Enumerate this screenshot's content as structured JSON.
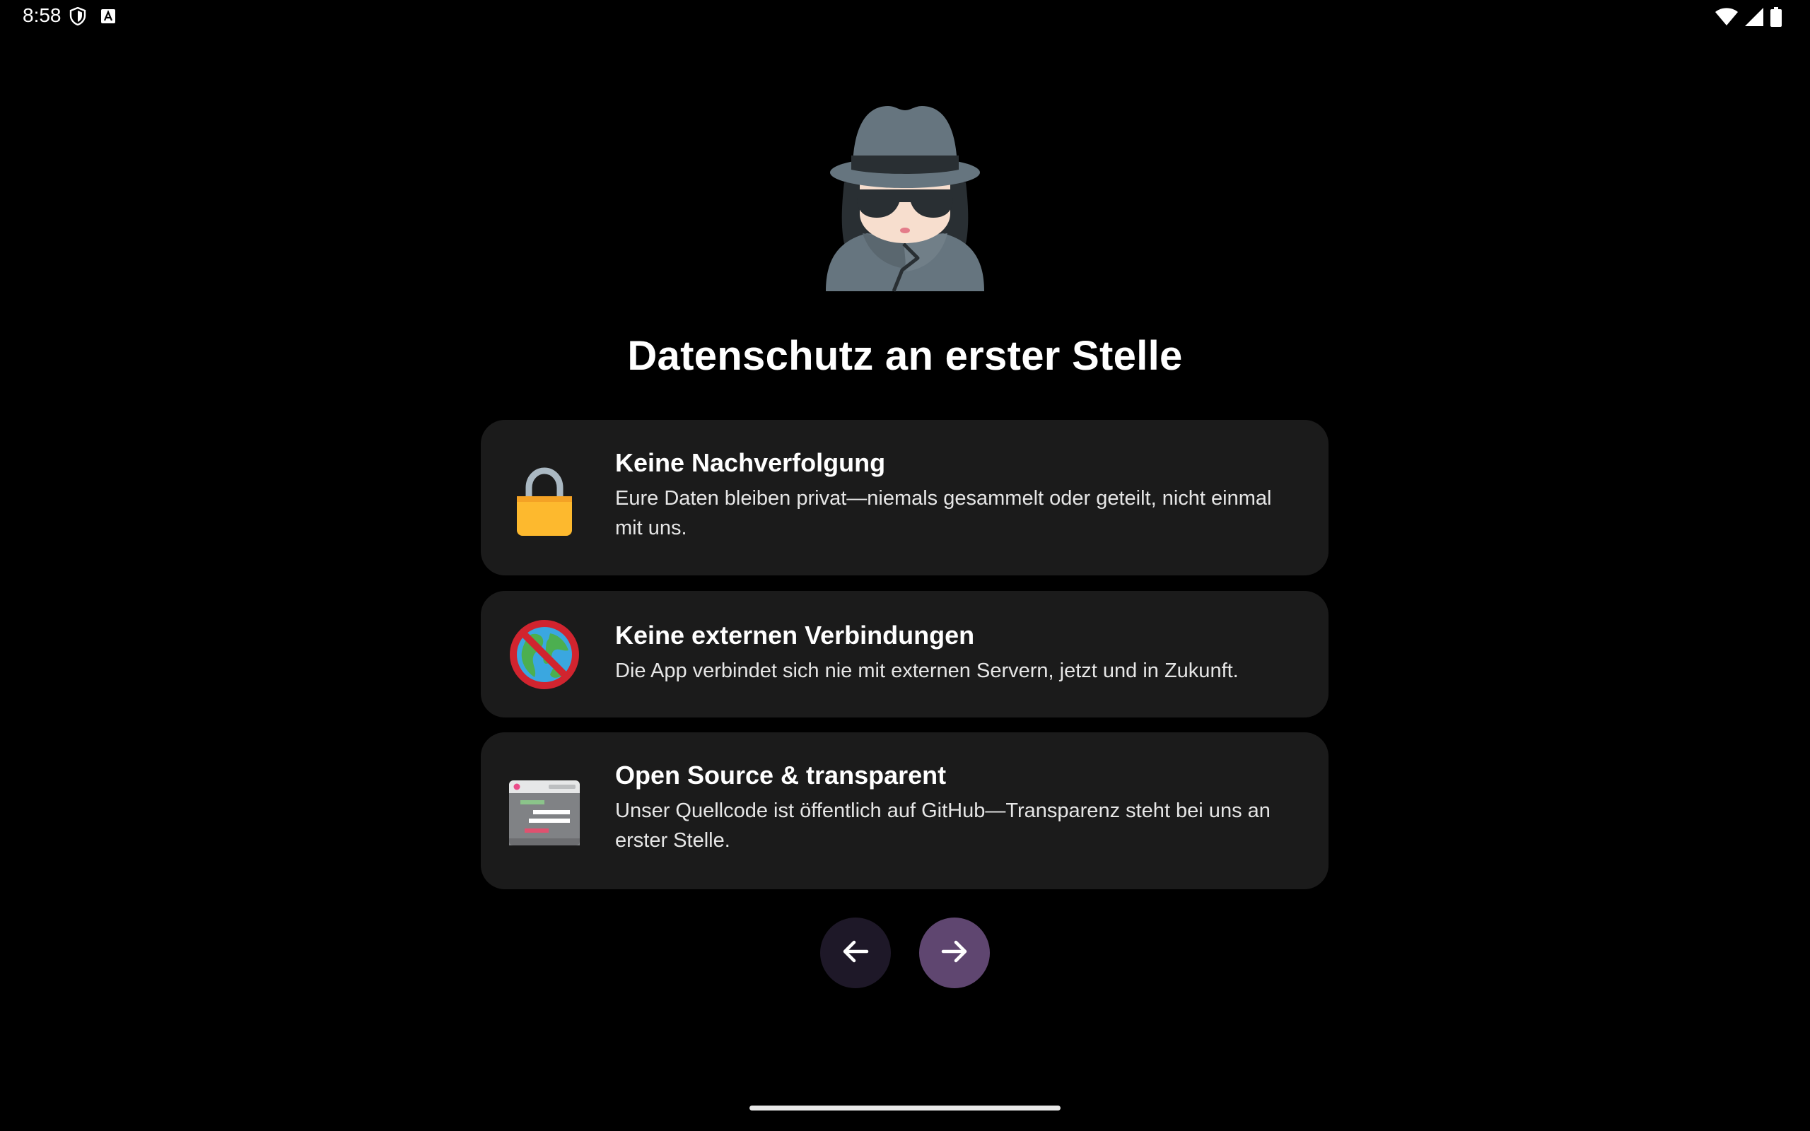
{
  "status_bar": {
    "time": "8:58",
    "left_icons": [
      "shield-icon",
      "keyboard-a-icon"
    ],
    "right_icons": [
      "wifi-icon",
      "cellular-signal-icon",
      "battery-icon"
    ]
  },
  "hero": {
    "icon": "detective-icon"
  },
  "title": "Datenschutz an erster Stelle",
  "cards": [
    {
      "icon": "lock-icon",
      "title": "Keine Nachverfolgung",
      "description": "Eure Daten bleiben privat—niemals gesammelt oder geteilt, nicht einmal mit uns."
    },
    {
      "icon": "no-globe-icon",
      "title": "Keine externen Verbindungen",
      "description": "Die App verbindet sich nie mit externen Servern, jetzt und in Zukunft."
    },
    {
      "icon": "code-window-icon",
      "title": "Open Source & transparent",
      "description": "Unser Quellcode ist öffentlich auf GitHub—Transparenz steht bei uns an erster Stelle."
    }
  ],
  "navigation": {
    "back_icon": "arrow-left-icon",
    "next_icon": "arrow-right-icon"
  },
  "colors": {
    "background": "#000000",
    "card": "#1b1b1b",
    "back_button": "#1e1828",
    "next_button": "#5f4670",
    "lock_body": "#fdb92e",
    "globe_ring": "#d1242f"
  }
}
